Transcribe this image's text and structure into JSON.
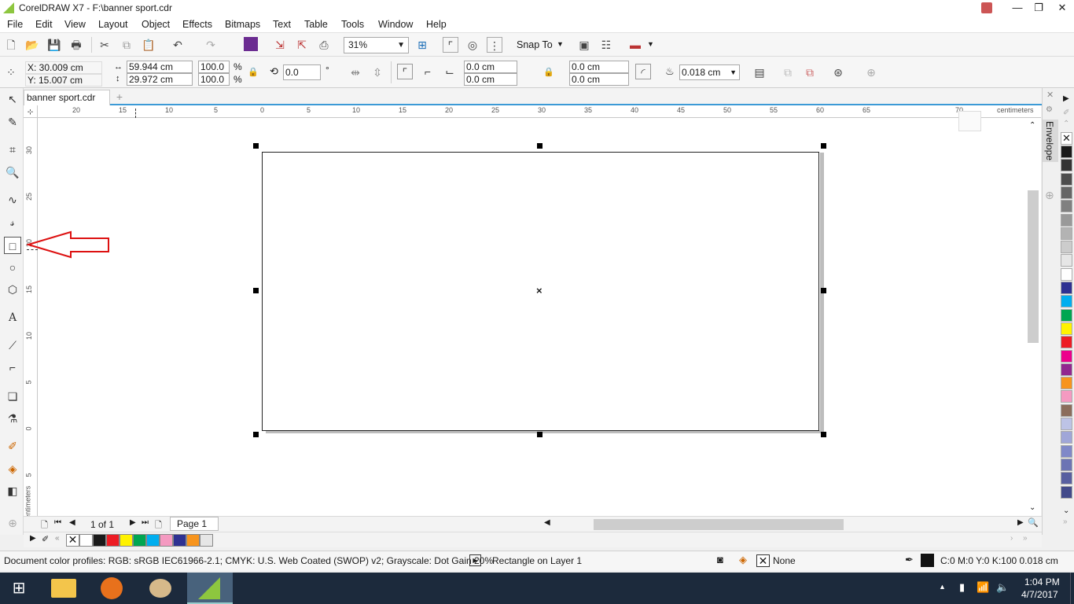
{
  "window": {
    "title": "CorelDRAW X7 - F:\\banner sport.cdr",
    "minimize": "—",
    "maximize": "❐",
    "close": "✕"
  },
  "menu": [
    "File",
    "Edit",
    "View",
    "Layout",
    "Object",
    "Effects",
    "Bitmaps",
    "Text",
    "Table",
    "Tools",
    "Window",
    "Help"
  ],
  "standard_toolbar": {
    "zoom_value": "31%",
    "snap_to_label": "Snap To"
  },
  "property_bar": {
    "x": "X: 30.009 cm",
    "y": "Y: 15.007 cm",
    "width": "59.944 cm",
    "height": "29.972 cm",
    "scale_x": "100.0",
    "scale_y": "100.0",
    "percent": "%",
    "rotation": "0.0",
    "degree": "°",
    "corner_tl": "0.0 cm",
    "corner_bl": "0.0 cm",
    "corner_tr": "0.0 cm",
    "corner_br": "0.0 cm",
    "outline_width": "0.018 cm"
  },
  "document_tab": {
    "label": "banner sport.cdr"
  },
  "rulers": {
    "unit": "centimeters",
    "h_ticks": [
      "20",
      "15",
      "10",
      "5",
      "0",
      "5",
      "10",
      "15",
      "20",
      "25",
      "30",
      "35",
      "40",
      "45",
      "50",
      "55",
      "60",
      "65",
      "70"
    ],
    "v_ticks": [
      "30",
      "25",
      "20",
      "15",
      "10",
      "5",
      "0",
      "5"
    ]
  },
  "docker": {
    "label": "Envelope"
  },
  "page_nav": {
    "counter": "1 of 1",
    "page_tab": "Page 1"
  },
  "palette_colors": [
    "#1a1a1a",
    "#333333",
    "#4d4d4d",
    "#666666",
    "#808080",
    "#999999",
    "#b3b3b3",
    "#cccccc",
    "#e6e6e6",
    "#ffffff",
    "#2e3192",
    "#00aeef",
    "#00a651",
    "#fff200",
    "#ed1c24",
    "#ec008c",
    "#92278f",
    "#f7941d",
    "#f49ac1",
    "#8b6d5c",
    "#bdc3e6",
    "#a0a6d8",
    "#8088c8",
    "#6c74b4",
    "#585fa0",
    "#424a8a"
  ],
  "document_palette": [
    "#ffffff",
    "#1a1a1a",
    "#ed1c24",
    "#fff200",
    "#00a651",
    "#00aeef",
    "#f49ac1",
    "#2e3192",
    "#f7941d",
    "#e6e6e6"
  ],
  "status": {
    "color_profiles": "Document color profiles: RGB: sRGB IEC61966-2.1; CMYK: U.S. Web Coated (SWOP) v2; Grayscale: Dot Gain 20%",
    "object_info": "Rectangle on Layer 1",
    "fill": "None",
    "outline": "C:0 M:0 Y:0 K:100  0.018 cm"
  },
  "taskbar": {
    "time": "1:04 PM",
    "date": "4/7/2017"
  }
}
